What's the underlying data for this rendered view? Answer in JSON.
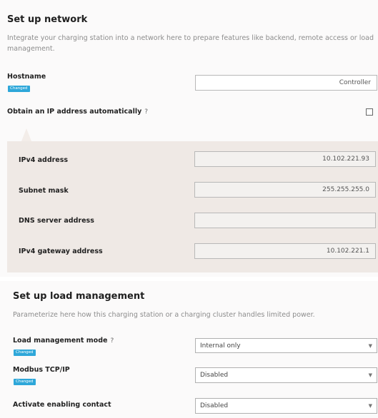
{
  "network": {
    "title": "Set up network",
    "description": "Integrate your charging station into a network here to prepare features like backend, remote access or load management.",
    "hostname": {
      "label": "Hostname",
      "badge": "Changed",
      "value": "Controller"
    },
    "obtain_ip": {
      "label": "Obtain an IP address automatically",
      "help": "?",
      "checked": false
    },
    "fields": [
      {
        "label": "IPv4 address",
        "value": "10.102.221.93"
      },
      {
        "label": "Subnet mask",
        "value": "255.255.255.0"
      },
      {
        "label": "DNS server address",
        "value": ""
      },
      {
        "label": "IPv4 gateway address",
        "value": "10.102.221.1"
      }
    ]
  },
  "load_management": {
    "title": "Set up load management",
    "description": "Parameterize here how this charging station or a charging cluster handles limited power.",
    "mode": {
      "label": "Load management mode",
      "help": "?",
      "badge": "Changed",
      "value": "Internal only"
    },
    "modbus": {
      "label": "Modbus TCP/IP",
      "badge": "Changed",
      "value": "Disabled"
    },
    "enabling_contact": {
      "label": "Activate enabling contact",
      "value": "Disabled"
    }
  },
  "colors": {
    "badge": "#2ea7d9",
    "panel": "#efe9e5"
  }
}
